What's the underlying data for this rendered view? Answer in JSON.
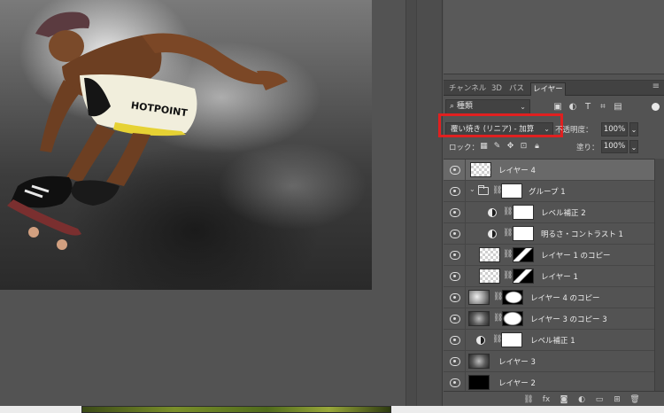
{
  "panel": {
    "tabs": [
      {
        "label": "チャンネル"
      },
      {
        "label": "3D"
      },
      {
        "label": "パス"
      },
      {
        "label": "レイヤー"
      }
    ],
    "filter": {
      "label": "種類"
    },
    "blend_mode": "覆い焼き (リニア) - 加算",
    "opacity_label": "不透明度：",
    "opacity_value": "100%",
    "lock_label": "ロック：",
    "fill_label": "塗り：",
    "fill_value": "100%"
  },
  "layers": [
    {
      "name": "レイヤー 4",
      "selected": true,
      "kind": "pixel"
    },
    {
      "name": "グループ 1",
      "kind": "group"
    },
    {
      "name": "レベル補正 2",
      "kind": "adjustment"
    },
    {
      "name": "明るさ・コントラスト 1",
      "kind": "adjustment"
    },
    {
      "name": "レイヤー 1 のコピー",
      "kind": "masked"
    },
    {
      "name": "レイヤー 1",
      "kind": "masked"
    },
    {
      "name": "レイヤー 4 のコピー",
      "kind": "masked"
    },
    {
      "name": "レイヤー 3 のコピー 3",
      "kind": "masked"
    },
    {
      "name": "レベル補正 1",
      "kind": "adjustment"
    },
    {
      "name": "レイヤー 3",
      "kind": "pixel"
    },
    {
      "name": "レイヤー 2",
      "kind": "pixel"
    }
  ],
  "artwork": {
    "shorts_text": "HOTPOINT"
  },
  "colors": {
    "highlight": "#e02020",
    "panel_bg": "#535353",
    "selected_row": "#696969"
  }
}
